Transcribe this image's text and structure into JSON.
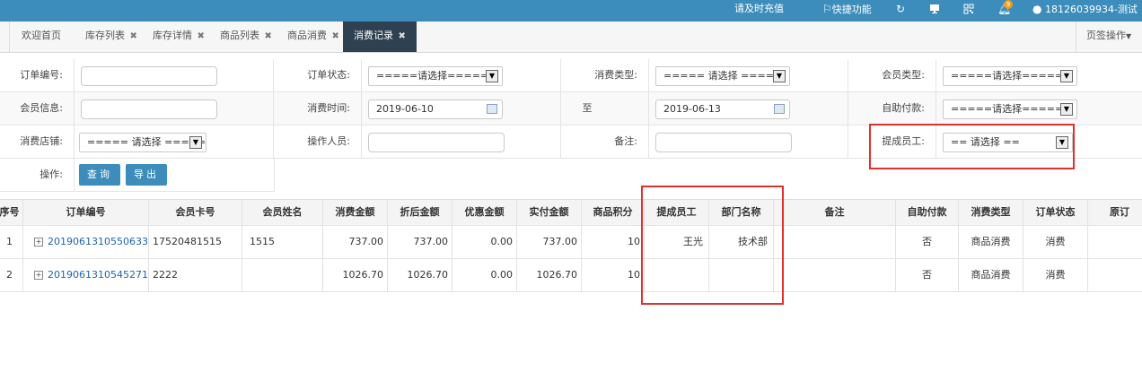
{
  "topbar": {
    "recharge_label": "请及时充值",
    "shortcut_label": "快捷功能",
    "notification_count": "9",
    "user_label": "18126039934-测试"
  },
  "tabs": [
    {
      "label": "欢迎首页",
      "closable": false
    },
    {
      "label": "库存列表",
      "closable": true
    },
    {
      "label": "库存详情",
      "closable": true
    },
    {
      "label": "商品列表",
      "closable": true
    },
    {
      "label": "商品消费",
      "closable": true
    },
    {
      "label": "消费记录",
      "closable": true,
      "active": true
    }
  ],
  "tab_close_glyph": "✖",
  "page_ops_label": "页签操作",
  "filters": {
    "order_no_label": "订单编号:",
    "order_no_value": "",
    "order_status_label": "订单状态:",
    "order_status_value": "=====请选择=====",
    "consume_type_label": "消费类型:",
    "consume_type_value": "===== 请选择 =====",
    "member_type_label": "会员类型:",
    "member_type_value": "=====请选择=====",
    "member_info_label": "会员信息:",
    "member_info_value": "",
    "consume_time_label": "消费时间:",
    "consume_time_from": "2019-06-10",
    "to_label": "至",
    "consume_time_to": "2019-06-13",
    "self_pay_label": "自助付款:",
    "self_pay_value": "=====请选择=====",
    "store_label": "消费店铺:",
    "store_value": "===== 请选择 =====",
    "operator_label": "操作人员:",
    "operator_value": "",
    "remark_label": "备注:",
    "remark_value": "",
    "staff_label": "提成员工:",
    "staff_value": "== 请选择 ==",
    "action_label": "操作:",
    "query_button": "查询",
    "export_button": "导出"
  },
  "table": {
    "headers": [
      "序号",
      "订单编号",
      "会员卡号",
      "会员姓名",
      "消费金额",
      "折后金额",
      "优惠金额",
      "实付金额",
      "商品积分",
      "提成员工",
      "部门名称",
      "备注",
      "自助付款",
      "消费类型",
      "订单状态",
      "原订"
    ],
    "rows": [
      [
        "1",
        "2019061310550633",
        "17520481515",
        "1515",
        "737.00",
        "737.00",
        "0.00",
        "737.00",
        "10",
        "王光",
        "技术部",
        "",
        "否",
        "商品消费",
        "消费",
        ""
      ],
      [
        "2",
        "2019061310545271",
        "2222",
        "",
        "1026.70",
        "1026.70",
        "0.00",
        "1026.70",
        "10",
        "",
        "",
        "",
        "否",
        "商品消费",
        "消费",
        ""
      ]
    ]
  },
  "colors": {
    "topbar": "#3c8dbc",
    "active_tab": "#2f4050",
    "button": "#3c8dbc",
    "highlight": "#e0312f",
    "link": "#1f63b3"
  }
}
